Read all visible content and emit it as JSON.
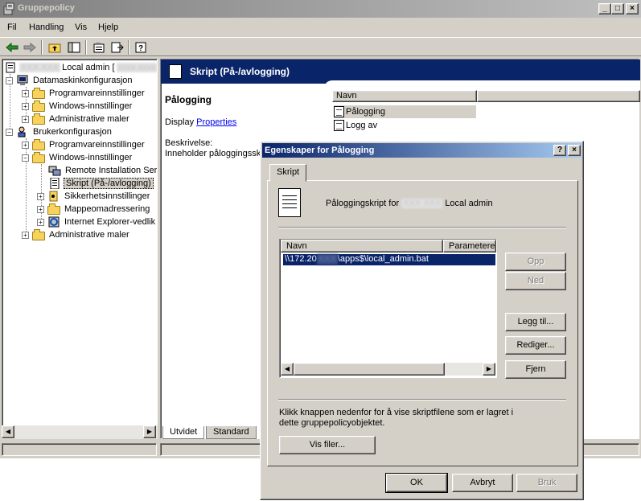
{
  "window": {
    "title": "Gruppepolicy"
  },
  "menu": [
    "Fil",
    "Handling",
    "Vis",
    "Hjelp"
  ],
  "tree": {
    "root_label_suffix": "Local admin [",
    "root_blur_a": "XXX XXX",
    "root_blur_b": "xxxx.xxxx",
    "items": [
      {
        "label": "Datamaskinkonfigurasjon"
      },
      {
        "label": "Programvareinnstillinger"
      },
      {
        "label": "Windows-innstillinger"
      },
      {
        "label": "Administrative maler"
      },
      {
        "label": "Brukerkonfigurasjon"
      },
      {
        "label": "Programvareinnstillinger"
      },
      {
        "label": "Windows-innstillinger"
      },
      {
        "label": "Remote Installation Ser"
      },
      {
        "label": "Skript (På-/avlogging)"
      },
      {
        "label": "Sikkerhetsinnstillinger"
      },
      {
        "label": "Mappeomadressering"
      },
      {
        "label": "Internet Explorer-vedlik"
      },
      {
        "label": "Administrative maler"
      }
    ]
  },
  "right": {
    "header": "Skript (På-/avlogging)",
    "detail_title": "Pålogging",
    "display_prefix": "Display",
    "display_link": "Properties",
    "description_label": "Beskrivelse:",
    "description_text": "Inneholder påloggingsskr",
    "list_header": "Navn",
    "list_items": [
      "Pålogging",
      "Logg av"
    ],
    "tabs": [
      "Utvidet",
      "Standard"
    ]
  },
  "dialog": {
    "title": "Egenskaper for Pålogging",
    "help_btn": "?",
    "close_btn": "×",
    "tab": "Skript",
    "script_for_prefix": "Påloggingskript for",
    "script_for_blur": "XXX XXX",
    "script_for_suffix": "Local admin",
    "columns": [
      "Navn",
      "Parametere"
    ],
    "row_prefix": "\\\\172.20",
    "row_blur": "XXX",
    "row_suffix": "\\apps$\\local_admin.bat",
    "buttons": {
      "up": "Opp",
      "down": "Ned",
      "add": "Legg til...",
      "edit": "Rediger...",
      "remove": "Fjern",
      "show_files": "Vis filer...",
      "ok": "OK",
      "cancel": "Avbryt",
      "apply": "Bruk"
    },
    "note": "Klikk knappen nedenfor for å vise skriptfilene som er lagret i dette gruppepolicyobjektet."
  }
}
